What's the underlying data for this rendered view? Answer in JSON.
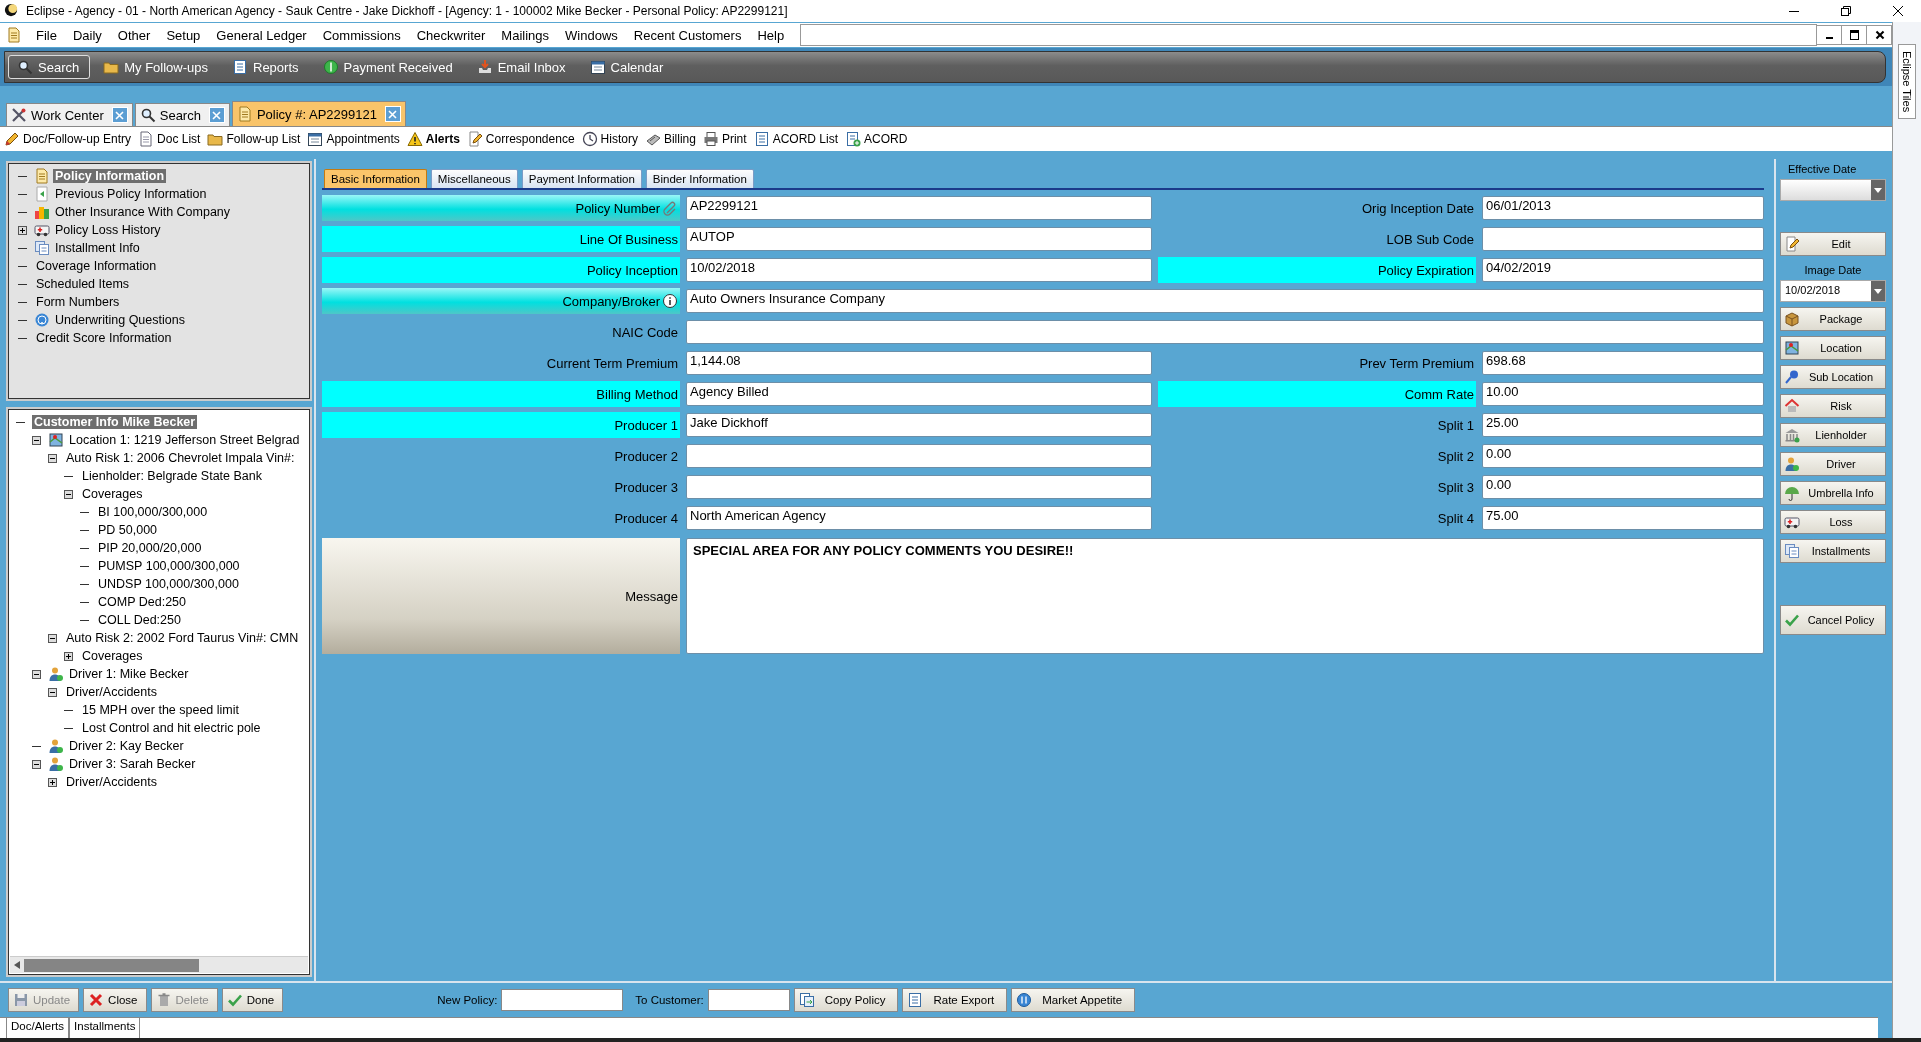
{
  "title_bar": {
    "title": "Eclipse - Agency - 01 - North American Agency - Sauk Centre - Jake Dickhoff - [Agency: 1 - 100002 Mike Becker - Personal Policy: AP2299121]"
  },
  "menu": [
    "File",
    "Daily",
    "Other",
    "Setup",
    "General Ledger",
    "Commissions",
    "Checkwriter",
    "Mailings",
    "Windows",
    "Recent Customers",
    "Help"
  ],
  "main_toolbar": [
    {
      "label": "Search",
      "selected": true
    },
    {
      "label": "My Follow-ups",
      "selected": false
    },
    {
      "label": "Reports",
      "selected": false
    },
    {
      "label": "Payment Received",
      "selected": false
    },
    {
      "label": "Email Inbox",
      "selected": false
    },
    {
      "label": "Calendar",
      "selected": false
    }
  ],
  "side_tab": "Eclipse Tiles",
  "document_tabs": [
    {
      "label": "Work Center",
      "selected": false
    },
    {
      "label": "Search",
      "selected": false
    },
    {
      "label": "Policy #: AP2299121",
      "selected": true
    }
  ],
  "action_toolbar": [
    {
      "label": "Doc/Follow-up Entry",
      "highlighted": false
    },
    {
      "label": "Doc List",
      "highlighted": false
    },
    {
      "label": "Follow-up List",
      "highlighted": false
    },
    {
      "label": "Appointments",
      "highlighted": false
    },
    {
      "label": "Alerts",
      "highlighted": true
    },
    {
      "label": "Correspondence",
      "highlighted": false
    },
    {
      "label": "History",
      "highlighted": false
    },
    {
      "label": "Billing",
      "highlighted": false
    },
    {
      "label": "Print",
      "highlighted": false
    },
    {
      "label": "ACORD List",
      "highlighted": false
    },
    {
      "label": "ACORD",
      "highlighted": false
    }
  ],
  "policy_tree": [
    {
      "label": "Policy Information",
      "kind": "policy",
      "selected": true
    },
    {
      "label": "Previous Policy Information",
      "kind": "history",
      "selected": false
    },
    {
      "label": "Other Insurance With Company",
      "kind": "company",
      "selected": false
    },
    {
      "label": "Policy Loss History",
      "kind": "loss",
      "selected": false,
      "expanded": false
    },
    {
      "label": "Installment Info",
      "kind": "installments",
      "selected": false
    },
    {
      "label": "Coverage Information",
      "selected": false
    },
    {
      "label": "Scheduled Items",
      "selected": false
    },
    {
      "label": "Form Numbers",
      "selected": false
    },
    {
      "label": "Underwriting Questions",
      "kind": "questions",
      "selected": false
    },
    {
      "label": "Credit Score Information",
      "selected": false
    }
  ],
  "customer_tree": [
    {
      "label": "Customer Info Mike Becker",
      "selected": true,
      "children": [
        {
          "label": "Location 1:  1219 Jefferson Street Belgrad",
          "kind": "location",
          "selected": false,
          "expanded": true,
          "children": [
            {
              "label": "Auto Risk 1:  2006 Chevrolet Impala Vin#:",
              "selected": false,
              "expanded": true,
              "children": [
                {
                  "label": "Lienholder: Belgrade State Bank",
                  "selected": false
                },
                {
                  "label": "Coverages",
                  "selected": false,
                  "expanded": true,
                  "children": [
                    {
                      "label": "BI 100,000/300,000",
                      "selected": false
                    },
                    {
                      "label": "PD 50,000",
                      "selected": false
                    },
                    {
                      "label": "PIP 20,000/20,000",
                      "selected": false
                    },
                    {
                      "label": "PUMSP 100,000/300,000",
                      "selected": false
                    },
                    {
                      "label": "UNDSP 100,000/300,000",
                      "selected": false
                    },
                    {
                      "label": "COMP Ded:250",
                      "selected": false
                    },
                    {
                      "label": "COLL Ded:250",
                      "selected": false
                    }
                  ]
                }
              ]
            },
            {
              "label": "Auto Risk 2:  2002 Ford Taurus Vin#: CMN",
              "selected": false,
              "expanded": true,
              "children": [
                {
                  "label": "Coverages",
                  "selected": false,
                  "expanded": false
                }
              ]
            }
          ]
        },
        {
          "label": "Driver 1: Mike Becker",
          "kind": "driver",
          "selected": false,
          "expanded": true,
          "children": [
            {
              "label": "Driver/Accidents",
              "selected": false,
              "expanded": true,
              "children": [
                {
                  "label": "15 MPH over the speed limit",
                  "selected": false
                },
                {
                  "label": "Lost Control and hit electric pole",
                  "selected": false
                }
              ]
            }
          ]
        },
        {
          "label": "Driver 2: Kay Becker",
          "kind": "driver",
          "selected": false
        },
        {
          "label": "Driver 3: Sarah Becker",
          "kind": "driver",
          "selected": false,
          "expanded": true,
          "children": [
            {
              "label": "Driver/Accidents",
              "selected": false,
              "expanded": false
            }
          ]
        }
      ]
    }
  ],
  "form_tabs": [
    {
      "label": "Basic Information",
      "selected": true
    },
    {
      "label": "Miscellaneous",
      "selected": false
    },
    {
      "label": "Payment Information",
      "selected": false
    },
    {
      "label": "Binder Information",
      "selected": false
    }
  ],
  "form_rows": [
    {
      "label": "Policy Number",
      "value": "AP2299121",
      "required": true,
      "linked": true,
      "right": {
        "label": "Orig Inception Date",
        "value": "06/01/2013",
        "required": false
      }
    },
    {
      "label": "Line Of Business",
      "value": "AUTOP",
      "required": true,
      "linked": false,
      "right": {
        "label": "LOB Sub Code",
        "required": false
      }
    },
    {
      "label": "Policy Inception",
      "value": "10/02/2018",
      "required": true,
      "linked": false,
      "right": {
        "label": "Policy Expiration",
        "value": "04/02/2019",
        "required": true
      }
    },
    {
      "label": "Company/Broker",
      "value": "Auto Owners Insurance Company",
      "required": true,
      "linked": true,
      "wide": true
    },
    {
      "label": "NAIC Code",
      "required": false,
      "linked": false,
      "wide": true
    },
    {
      "label": "Current Term Premium",
      "value": "1,144.08",
      "required": false,
      "linked": false,
      "right": {
        "label": "Prev Term Premium",
        "value": "698.68",
        "required": false
      }
    },
    {
      "label": "Billing Method",
      "value": "Agency Billed",
      "required": true,
      "linked": false,
      "right": {
        "label": "Comm Rate",
        "value": "10.00",
        "required": true
      }
    },
    {
      "label": "Producer 1",
      "value": "Jake Dickhoff",
      "required": true,
      "linked": false,
      "right": {
        "label": "Split 1",
        "value": "25.00",
        "required": false
      }
    },
    {
      "label": "Producer 2",
      "required": false,
      "linked": false,
      "right": {
        "label": "Split 2",
        "value": "0.00",
        "required": false
      }
    },
    {
      "label": "Producer 3",
      "required": false,
      "linked": false,
      "right": {
        "label": "Split 3",
        "value": "0.00",
        "required": false
      }
    },
    {
      "label": "Producer 4",
      "value": "North American Agency",
      "required": false,
      "linked": false,
      "right": {
        "label": "Split 4",
        "value": "75.00",
        "required": false
      }
    }
  ],
  "message": {
    "label": "Message",
    "value": "SPECIAL AREA FOR ANY POLICY COMMENTS YOU DESIRE!!"
  },
  "right_panel": {
    "effective_date_label": "Effective Date",
    "edit_button": "Edit",
    "image_date_label": "Image Date",
    "image_date": "10/02/2018",
    "buttons": [
      "Package",
      "Location",
      "Sub Location",
      "Risk",
      "Lienholder",
      "Driver",
      "Umbrella Info",
      "Loss",
      "Installments"
    ],
    "cancel_button": "Cancel Policy"
  },
  "bottom_bar": {
    "buttons": [
      {
        "label": "Update",
        "disabled": true
      },
      {
        "label": "Close",
        "disabled": false
      },
      {
        "label": "Delete",
        "disabled": true
      },
      {
        "label": "Done",
        "disabled": false
      }
    ],
    "new_policy_label": "New Policy:",
    "to_customer_label": "To Customer:",
    "actions": [
      "Copy Policy",
      "Rate Export",
      "Market Appetite"
    ]
  },
  "status_tabs": [
    "Doc/Alerts",
    "Installments"
  ]
}
